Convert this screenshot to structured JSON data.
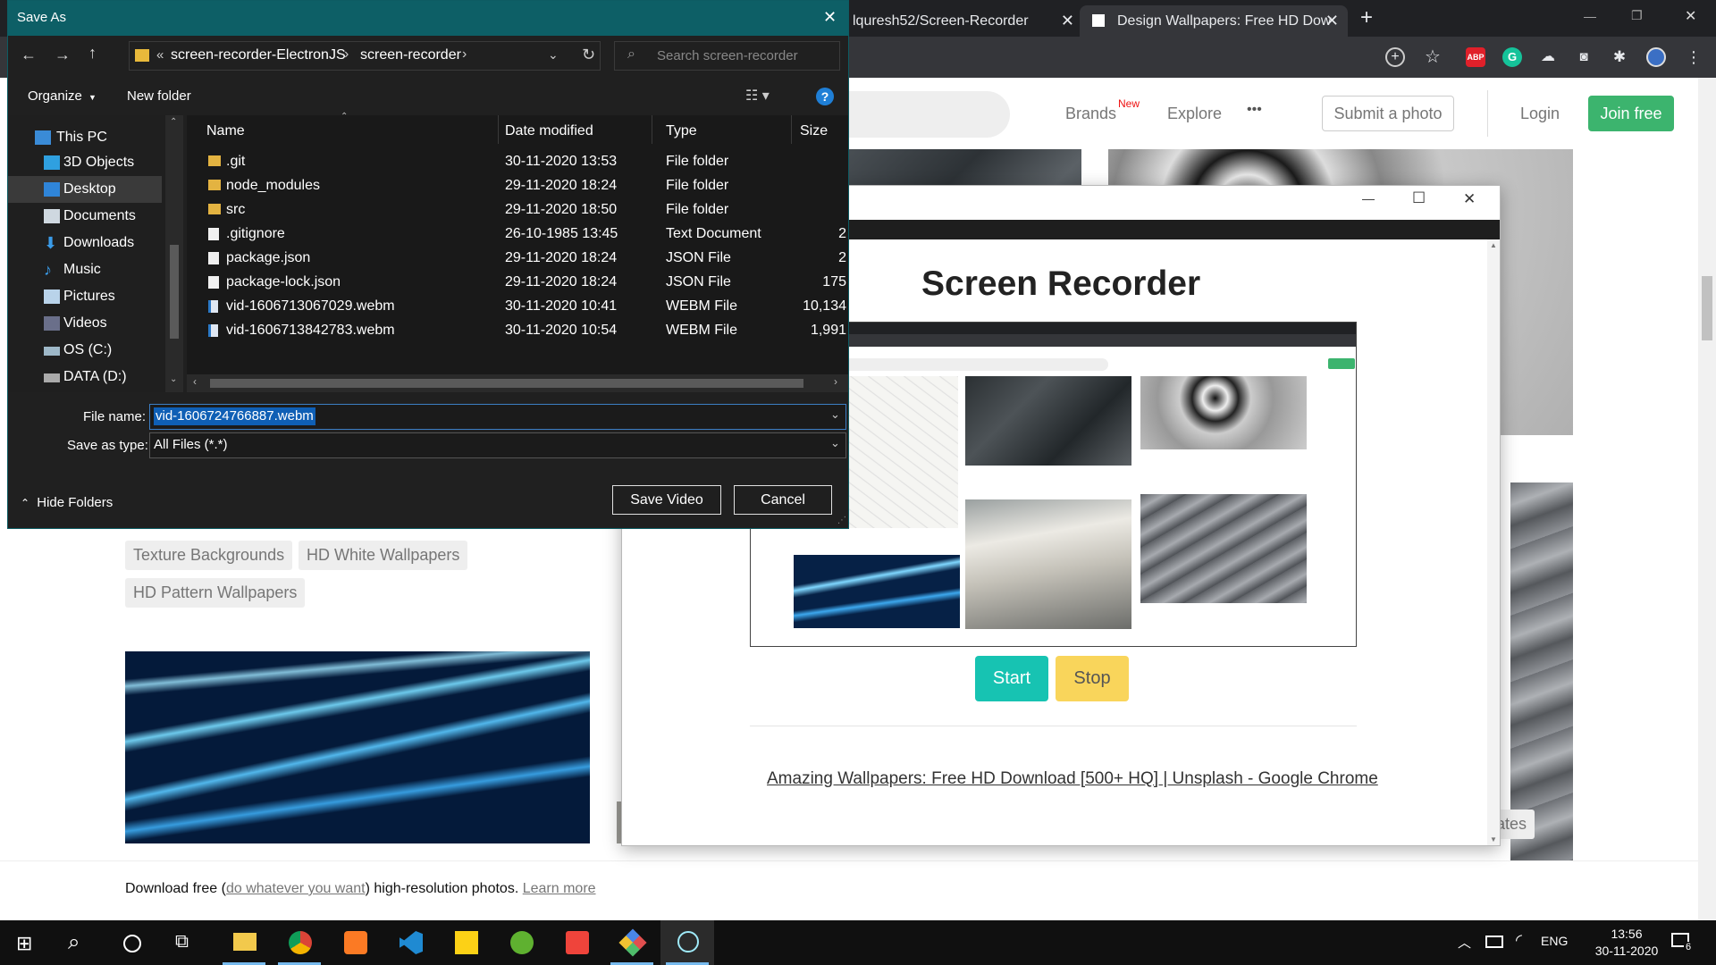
{
  "chrome": {
    "tabs": [
      {
        "title": "lquresh52/Screen-Recorder"
      },
      {
        "title": "Design Wallpapers: Free HD Dow"
      }
    ],
    "new_tab": "+",
    "window_controls": {
      "minimize": "—",
      "restore": "❐",
      "close": "✕"
    },
    "extensions": {
      "abp": "ABP",
      "grammarly": "G"
    }
  },
  "unsplash": {
    "nav": {
      "brands": "Brands",
      "new_badge": "New",
      "explore": "Explore",
      "more": "•••",
      "submit": "Submit a photo",
      "login": "Login",
      "join": "Join free"
    },
    "tags_col1": [
      "Texture Backgrounds",
      "HD White Wallpapers",
      "HD Pattern Wallpapers"
    ],
    "tag_partial": "ates",
    "footer_text": {
      "prefix": "Download free (",
      "link": "do whatever you want",
      "middle": ") high-resolution photos.",
      "learn_more": "Learn more"
    }
  },
  "recorder": {
    "title": "Screen Recorder",
    "start": "Start",
    "stop": "Stop",
    "source_link": "Amazing Wallpapers: Free HD Download [500+ HQ] | Unsplash - Google Chrome",
    "window_controls": {
      "minimize": "—",
      "maximize": "☐",
      "close": "✕"
    }
  },
  "dialog": {
    "title": "Save As",
    "close": "✕",
    "breadcrumb": {
      "root": "«",
      "folder1": "screen-recorder-ElectronJS",
      "sep": "›",
      "folder2": "screen-recorder"
    },
    "search_placeholder": "Search screen-recorder",
    "organize": "Organize",
    "new_folder": "New folder",
    "help": "?",
    "nav_items": [
      "This PC",
      "3D Objects",
      "Desktop",
      "Documents",
      "Downloads",
      "Music",
      "Pictures",
      "Videos",
      "OS (C:)",
      "DATA (D:)"
    ],
    "columns": {
      "name": "Name",
      "date": "Date modified",
      "type": "Type",
      "size": "Size"
    },
    "files": [
      {
        "name": ".git",
        "date": "30-11-2020 13:53",
        "type": "File folder",
        "size": "",
        "kind": "folder"
      },
      {
        "name": "node_modules",
        "date": "29-11-2020 18:24",
        "type": "File folder",
        "size": "",
        "kind": "folder"
      },
      {
        "name": "src",
        "date": "29-11-2020 18:50",
        "type": "File folder",
        "size": "",
        "kind": "folder"
      },
      {
        "name": ".gitignore",
        "date": "26-10-1985 13:45",
        "type": "Text Document",
        "size": "2",
        "kind": "file"
      },
      {
        "name": "package.json",
        "date": "29-11-2020 18:24",
        "type": "JSON File",
        "size": "2",
        "kind": "file"
      },
      {
        "name": "package-lock.json",
        "date": "29-11-2020 18:24",
        "type": "JSON File",
        "size": "175",
        "kind": "file"
      },
      {
        "name": "vid-1606713067029.webm",
        "date": "30-11-2020 10:41",
        "type": "WEBM File",
        "size": "10,134",
        "kind": "video"
      },
      {
        "name": "vid-1606713842783.webm",
        "date": "30-11-2020 10:54",
        "type": "WEBM File",
        "size": "1,991",
        "kind": "video"
      }
    ],
    "file_name_label": "File name:",
    "file_name_value": "vid-1606724766887.webm",
    "save_type_label": "Save as type:",
    "save_type_value": "All Files (*.*)",
    "save_button": "Save Video",
    "cancel_button": "Cancel",
    "hide_folders": "Hide Folders"
  },
  "taskbar": {
    "language": "ENG",
    "time": "13:56",
    "date": "30-11-2020",
    "notification_count": "6"
  },
  "colors": {
    "accent_teal": "#0d5f66",
    "join_green": "#3cb46e",
    "start_teal": "#17c3b2",
    "stop_yellow": "#f9d55b"
  }
}
